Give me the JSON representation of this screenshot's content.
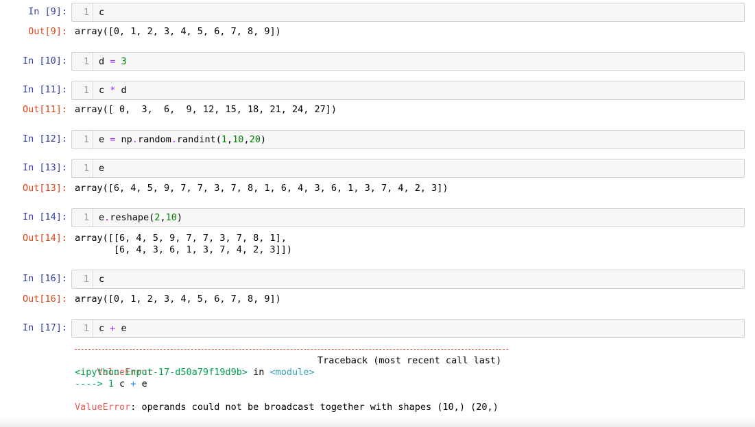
{
  "cells": [
    {
      "in_prompt": "In [9]:",
      "line_no": "1",
      "code_tokens": [
        {
          "t": "c",
          "c": ""
        }
      ],
      "out_prompt": "Out[9]:",
      "output": "array([0, 1, 2, 3, 4, 5, 6, 7, 8, 9])"
    },
    {
      "in_prompt": "In [10]:",
      "line_no": "1",
      "code_tokens": [
        {
          "t": "d ",
          "c": ""
        },
        {
          "t": "=",
          "c": "op"
        },
        {
          "t": " ",
          "c": ""
        },
        {
          "t": "3",
          "c": "num"
        }
      ]
    },
    {
      "in_prompt": "In [11]:",
      "line_no": "1",
      "code_tokens": [
        {
          "t": "c ",
          "c": ""
        },
        {
          "t": "*",
          "c": "op"
        },
        {
          "t": " d",
          "c": ""
        }
      ],
      "out_prompt": "Out[11]:",
      "output": "array([ 0,  3,  6,  9, 12, 15, 18, 21, 24, 27])"
    },
    {
      "in_prompt": "In [12]:",
      "line_no": "1",
      "code_tokens": [
        {
          "t": "e ",
          "c": ""
        },
        {
          "t": "=",
          "c": "op"
        },
        {
          "t": " np",
          "c": ""
        },
        {
          "t": ".",
          "c": "op"
        },
        {
          "t": "random",
          "c": ""
        },
        {
          "t": ".",
          "c": "op"
        },
        {
          "t": "randint(",
          "c": ""
        },
        {
          "t": "1",
          "c": "num"
        },
        {
          "t": ",",
          "c": ""
        },
        {
          "t": "10",
          "c": "num"
        },
        {
          "t": ",",
          "c": ""
        },
        {
          "t": "20",
          "c": "num"
        },
        {
          "t": ")",
          "c": ""
        }
      ]
    },
    {
      "in_prompt": "In [13]:",
      "line_no": "1",
      "code_tokens": [
        {
          "t": "e",
          "c": ""
        }
      ],
      "out_prompt": "Out[13]:",
      "output": "array([6, 4, 5, 9, 7, 7, 3, 7, 8, 1, 6, 4, 3, 6, 1, 3, 7, 4, 2, 3])"
    },
    {
      "in_prompt": "In [14]:",
      "line_no": "1",
      "code_tokens": [
        {
          "t": "e",
          "c": ""
        },
        {
          "t": ".",
          "c": "op"
        },
        {
          "t": "reshape(",
          "c": ""
        },
        {
          "t": "2",
          "c": "num"
        },
        {
          "t": ",",
          "c": ""
        },
        {
          "t": "10",
          "c": "num"
        },
        {
          "t": ")",
          "c": ""
        }
      ],
      "out_prompt": "Out[14]:",
      "output": "array([[6, 4, 5, 9, 7, 7, 3, 7, 8, 1],\n       [6, 4, 3, 6, 1, 3, 7, 4, 2, 3]])"
    },
    {
      "in_prompt": "In [16]:",
      "line_no": "1",
      "code_tokens": [
        {
          "t": "c",
          "c": ""
        }
      ],
      "out_prompt": "Out[16]:",
      "output": "array([0, 1, 2, 3, 4, 5, 6, 7, 8, 9])"
    },
    {
      "in_prompt": "In [17]:",
      "line_no": "1",
      "code_tokens": [
        {
          "t": "c ",
          "c": ""
        },
        {
          "t": "+",
          "c": "op"
        },
        {
          "t": " e",
          "c": ""
        }
      ]
    }
  ],
  "traceback": {
    "error_name": "ValueError",
    "header_right": "Traceback (most recent call last)",
    "input_ref": "<ipython-input-17-d50a79f19d9b>",
    "in_word": " in ",
    "module_ref": "<module>",
    "arrow": "---->",
    "arrow_line_no": " 1",
    "arrow_code_a": " c ",
    "arrow_code_op": "+",
    "arrow_code_b": " e",
    "error_message": ": operands could not be broadcast together with shapes (10,) (20,)"
  },
  "colors": {
    "in_prompt": "#303f9f",
    "out_prompt": "#d84315",
    "operator": "#aa22ff",
    "number": "#008000",
    "traceback_red": "#e75c58",
    "traceback_green": "#00a250",
    "traceback_cyan": "#33a5b4",
    "traceback_blue": "#208ffb"
  }
}
